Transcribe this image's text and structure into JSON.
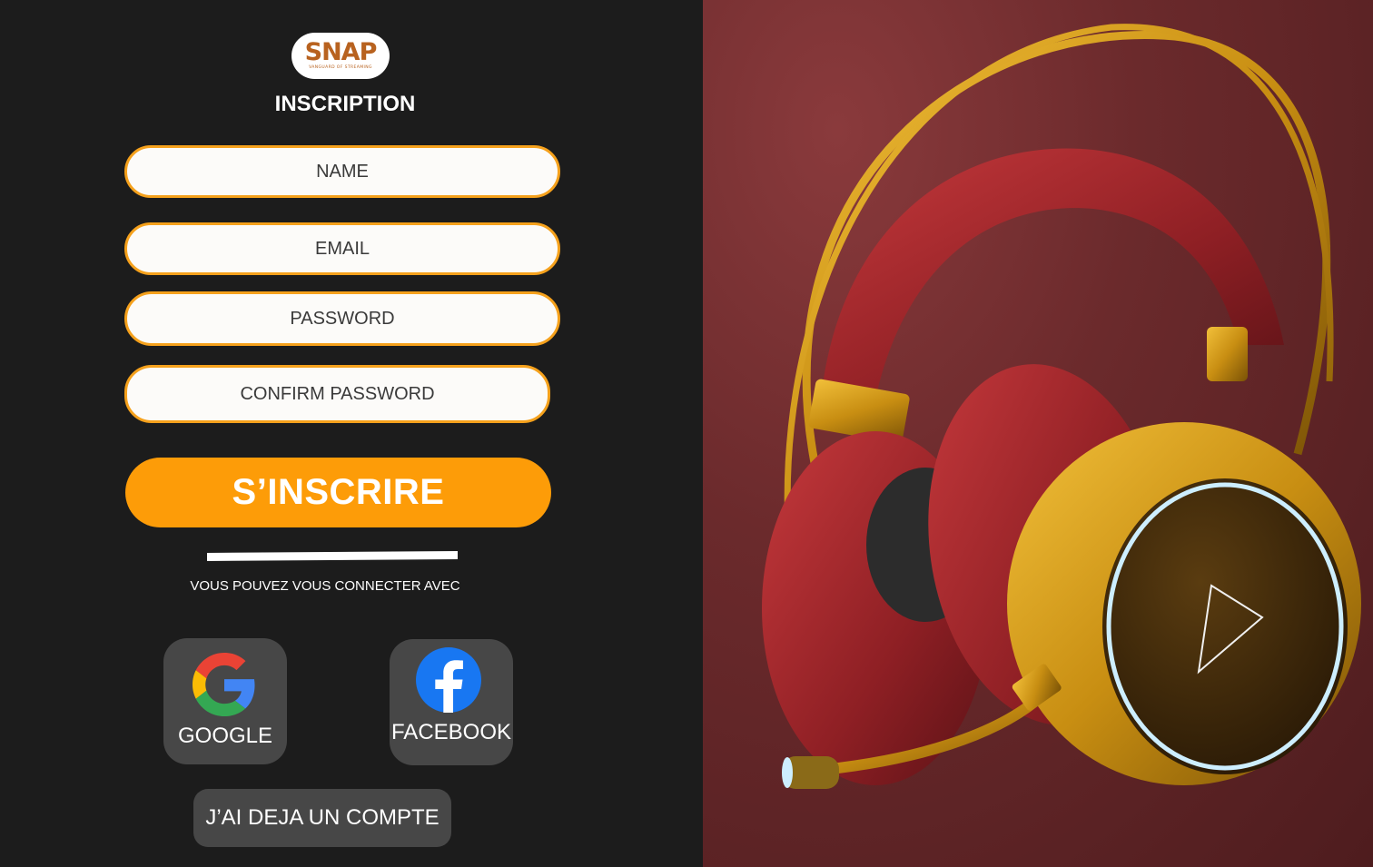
{
  "brand": {
    "logo_word": "SNAP",
    "logo_tagline": "VANGUARD OF STREAMING",
    "accent": "#fd9c08",
    "field_border": "#f5a11c",
    "logo_color": "#b8621f"
  },
  "page": {
    "title": "INSCRIPTION"
  },
  "form": {
    "name_placeholder": "NAME",
    "email_placeholder": "EMAIL",
    "password_placeholder": "PASSWORD",
    "confirm_placeholder": "CONFIRM PASSWORD",
    "submit_label": "S’INSCRIRE"
  },
  "social": {
    "caption": "VOUS POUVEZ VOUS CONNECTER AVEC",
    "google_label": "GOOGLE",
    "google_icon": "google-g-icon",
    "facebook_label": "FACEBOOK",
    "facebook_icon": "facebook-f-icon"
  },
  "footer": {
    "existing_account_label": "J’AI DEJA UN COMPTE"
  },
  "hero": {
    "subject": "headphones-image",
    "panel_color": "#6b2a2c"
  }
}
